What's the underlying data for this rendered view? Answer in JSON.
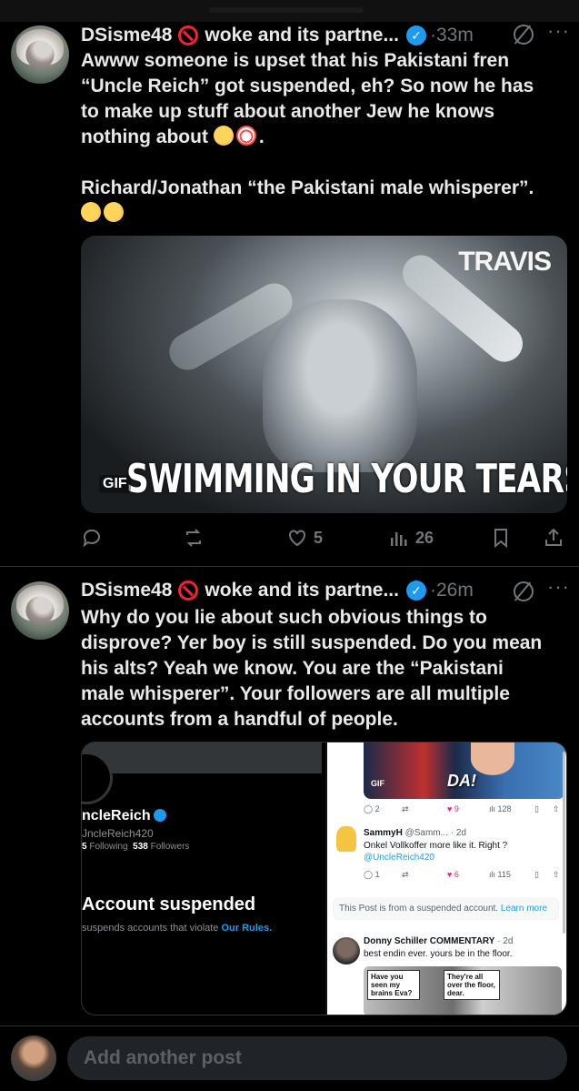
{
  "posts": [
    {
      "author": "DSisme48",
      "display_suffix": "woke and its partne...",
      "time": "33m",
      "text_lines": [
        "Awww someone is upset that his Pakistani fren",
        "“Uncle Reich” got suspended, eh? So now he has",
        "to make up stuff about another Jew he knows",
        "nothing about",
        "",
        "Richard/Jonathan “the Pakistani male whisperer”."
      ],
      "gif": {
        "brand": "TRAVIS",
        "caption": "SWIMMING IN YOUR TEARS",
        "label": "GIF"
      },
      "likes": "5",
      "views": "26"
    },
    {
      "author": "DSisme48",
      "display_suffix": "woke and its partne...",
      "time": "26m",
      "text_lines": [
        "Why do you lie about such obvious things to",
        "disprove? Yer boy is still suspended. Do you mean",
        "his alts? Yeah we know. You are the “Pakistani",
        "male whisperer”. Your followers are all multiple",
        "accounts from a handful of people."
      ],
      "screenshot_left": {
        "name": "ncleReich",
        "handle": "JncleReich420",
        "following_count": "5",
        "following_label": "Following",
        "followers_count": "538",
        "followers_label": "Followers",
        "suspended_title": "Account suspended",
        "rules_text": "suspends accounts that violate",
        "rules_link": "Our Rules."
      },
      "screenshot_right": {
        "gif_text": "DA!",
        "gif_label": "GIF",
        "row1": {
          "replies": "2",
          "likes": "9",
          "views": "128"
        },
        "reply_author": "SammyH",
        "reply_handle": "@Samm... · 2d",
        "reply_text": "Onkel Vollkoffer more like it. Right ?",
        "reply_mention": "@UncleReich420",
        "row2": {
          "replies": "1",
          "likes": "6",
          "views": "115"
        },
        "notice_text": "This Post is from a suspended account.",
        "notice_link": "Learn more",
        "second_author": "Donny Schiller COMMENTARY",
        "second_time": "· 2d",
        "second_text": "best endin ever. yours be in the floor.",
        "meme_left": "Have you seen my brains Eva?",
        "meme_right": "They're all over the floor, dear."
      }
    }
  ],
  "reply_placeholder": "Add another post",
  "colors": {
    "accent": "#1d9bf0",
    "like": "#f91880",
    "muted": "#71767b",
    "block": "#f4212e"
  }
}
